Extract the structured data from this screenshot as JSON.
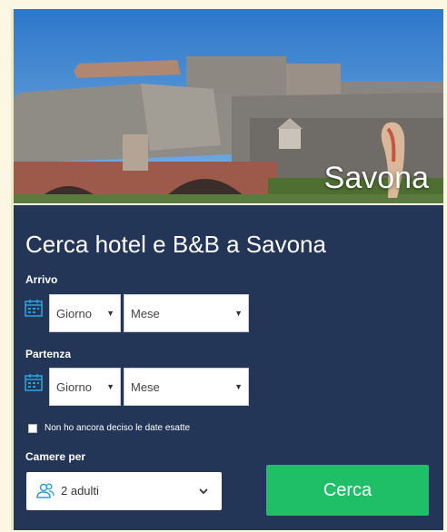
{
  "hero": {
    "city": "Savona"
  },
  "form": {
    "title": "Cerca hotel e B&B a Savona",
    "checkin": {
      "label": "Arrivo",
      "day": "Giorno",
      "month": "Mese"
    },
    "checkout": {
      "label": "Partenza",
      "day": "Giorno",
      "month": "Mese"
    },
    "no_dates_label": "Non ho ancora deciso le date esatte",
    "rooms": {
      "label": "Camere per",
      "value": "2 adulti"
    },
    "search_label": "Cerca"
  },
  "colors": {
    "panel": "#233658",
    "button": "#1fbf67",
    "icon": "#2a9fd8",
    "page": "#fbf7e2"
  },
  "icons": [
    "calendar-icon",
    "users-icon",
    "chevron-down-icon"
  ]
}
